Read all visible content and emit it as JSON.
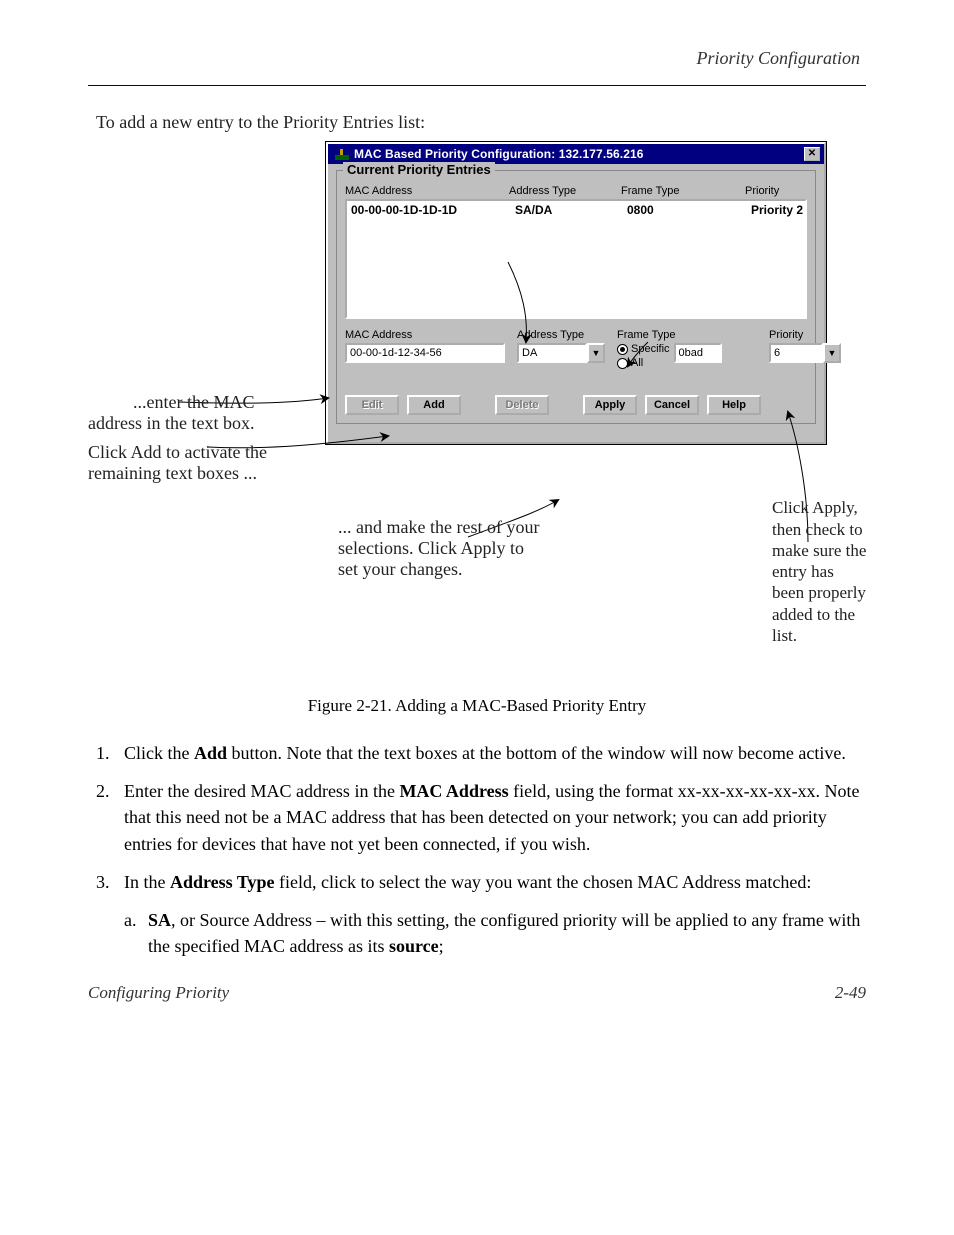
{
  "header": {
    "section": "Priority Configuration"
  },
  "intro": "To add a new entry to the Priority Entries list:",
  "dialog": {
    "title": "MAC Based Priority Configuration: 132.177.56.216",
    "group_title": "Current Priority Entries",
    "cols": {
      "c1": "MAC Address",
      "c2": "Address Type",
      "c3": "Frame Type",
      "c4": "Priority"
    },
    "row": {
      "mac": "00-00-00-1D-1D-1D",
      "type": "SA/DA",
      "frame": "0800",
      "prio": "Priority 2"
    },
    "labels": {
      "mac": "MAC Address",
      "addr": "Address Type",
      "frame": "Frame Type",
      "prio": "Priority"
    },
    "fields": {
      "mac": "00-00-1d-12-34-56",
      "addr": "DA",
      "radio_specific": "Specific",
      "radio_all": "All",
      "frame": "0bad",
      "prio": "6"
    },
    "buttons": {
      "edit": "Edit",
      "add": "Add",
      "delete": "Delete",
      "apply": "Apply",
      "cancel": "Cancel",
      "help": "Help"
    }
  },
  "annotations": {
    "a1": "...enter the MAC\naddress in the text box.",
    "a2": "Click Add to activate the\nremaining text boxes ...",
    "a3": "... and make the rest of your\nselections. Click Apply to\nset your changes.",
    "a4": "Click Apply,\nthen check to\nmake sure the\nentry has\nbeen properly\nadded to the\nlist."
  },
  "caption": "Figure 2-21. Adding a MAC-Based Priority Entry",
  "steps": {
    "s1_n": "1.",
    "s1": "Click the Add button. Note that the text boxes at the bottom of the window will now become active.",
    "s2_n": "2.",
    "s2": "Enter the desired MAC address in the MAC Address field, using the format xx-xx-xx-xx-xx-xx. Note that this need not be a MAC address that has been detected on your network; you can add priority entries for devices that have not yet been connected, if you wish.",
    "s3_n": "3.",
    "s3_a": "In the Address Type field, click to select the way you want the chosen MAC Address matched:",
    "s3_sa_n": "a.",
    "s3_sa": "SA, or Source Address – with this setting, the configured priority will be applied to any frame with the specified MAC address as its source;"
  },
  "footer": {
    "left": "Configuring Priority",
    "right": "2-49"
  }
}
